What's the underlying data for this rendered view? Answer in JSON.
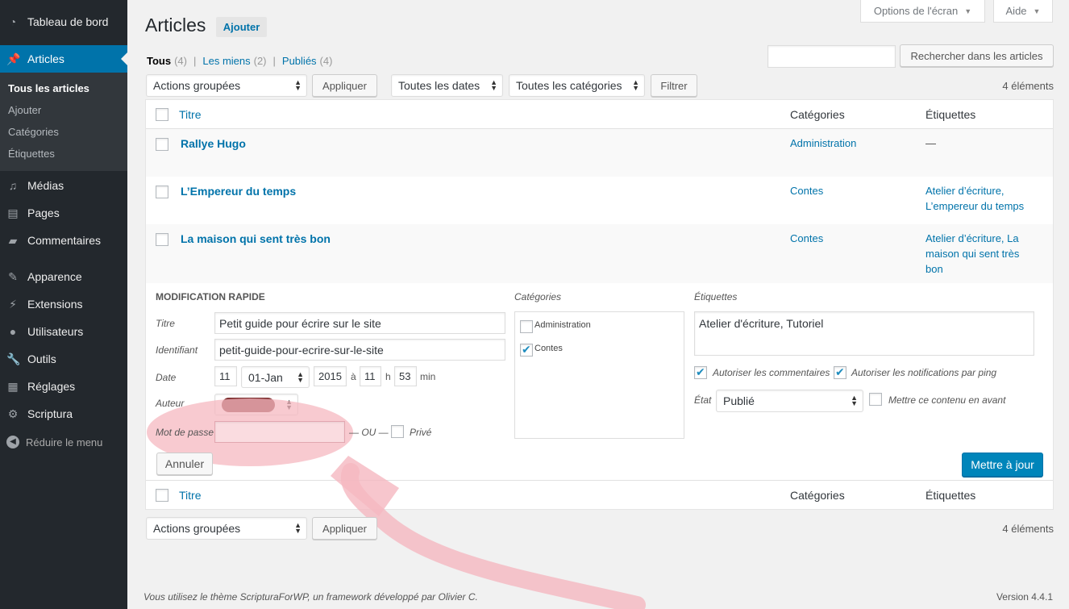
{
  "sidebar": {
    "dashboard": {
      "label": "Tableau de bord",
      "icon": "dashboard-icon"
    },
    "articles": {
      "label": "Articles",
      "icon": "pin-icon"
    },
    "submenu": [
      "Tous les articles",
      "Ajouter",
      "Catégories",
      "Étiquettes"
    ],
    "items": [
      {
        "label": "Médias",
        "icon": "media-icon"
      },
      {
        "label": "Pages",
        "icon": "pages-icon"
      },
      {
        "label": "Commentaires",
        "icon": "comments-icon"
      },
      {
        "label": "Apparence",
        "icon": "brush-icon"
      },
      {
        "label": "Extensions",
        "icon": "plugin-icon"
      },
      {
        "label": "Utilisateurs",
        "icon": "users-icon"
      },
      {
        "label": "Outils",
        "icon": "wrench-icon"
      },
      {
        "label": "Réglages",
        "icon": "settings-icon"
      },
      {
        "label": "Scriptura",
        "icon": "gear-icon"
      }
    ],
    "collapse": "Réduire le menu"
  },
  "header": {
    "screen_options": "Options de l'écran",
    "help": "Aide",
    "title": "Articles",
    "add_new": "Ajouter"
  },
  "views": {
    "all": {
      "label": "Tous",
      "count": "(4)"
    },
    "mine": {
      "label": "Les miens",
      "count": "(2)"
    },
    "published": {
      "label": "Publiés",
      "count": "(4)"
    },
    "sep": "|"
  },
  "search": {
    "value": "",
    "button": "Rechercher dans les articles"
  },
  "tablenav_top": {
    "bulk": "Actions groupées",
    "apply": "Appliquer",
    "dates": "Toutes les dates",
    "categories": "Toutes les catégories",
    "filter": "Filtrer",
    "count": "4 éléments"
  },
  "columns": {
    "title": "Titre",
    "categories": "Catégories",
    "tags": "Étiquettes"
  },
  "posts": [
    {
      "title": "Rallye Hugo",
      "categories": "Administration",
      "tags": [
        "—"
      ]
    },
    {
      "title": "L’Empereur du temps",
      "categories": "Contes",
      "tags": [
        "Atelier d’écriture,",
        "L’empereur du temps"
      ]
    },
    {
      "title": "La maison qui sent très bon",
      "categories": "Contes",
      "tags": [
        "Atelier d’écriture, La",
        "maison qui sent très",
        "bon"
      ]
    }
  ],
  "quick_edit": {
    "heading": "MODIFICATION RAPIDE",
    "title_label": "Titre",
    "title_value": "Petit guide pour écrire sur le site",
    "slug_label": "Identifiant",
    "slug_value": "petit-guide-pour-ecrire-sur-le-site",
    "date_label": "Date",
    "day": "11",
    "month": "01-Jan",
    "year": "2015",
    "at": "à",
    "hour": "11",
    "h": "h",
    "minute": "53",
    "min": "min",
    "author_label": "Auteur",
    "author_color": "#7a2a2a",
    "password_label": "Mot de passe",
    "password_value": "",
    "or": "— OU —",
    "private": "Privé",
    "cancel": "Annuler",
    "categories_label": "Catégories",
    "cat_options": [
      {
        "label": "Administration",
        "checked": false
      },
      {
        "label": "Contes",
        "checked": true
      }
    ],
    "tags_label": "Étiquettes",
    "tags_value": "Atelier d'écriture, Tutoriel",
    "allow_comments": "Autoriser les commentaires",
    "allow_pings": "Autoriser les notifications par ping",
    "status_label": "État",
    "status_value": "Publié",
    "sticky": "Mettre ce contenu en avant",
    "update": "Mettre à jour"
  },
  "tablenav_bottom": {
    "bulk": "Actions groupées",
    "apply": "Appliquer",
    "count": "4 éléments"
  },
  "footer": {
    "left": "Vous utilisez le thème ScripturaForWP, un framework développé par Olivier C.",
    "version": "Version 4.4.1"
  },
  "annotation_color": "#f5b8c0"
}
